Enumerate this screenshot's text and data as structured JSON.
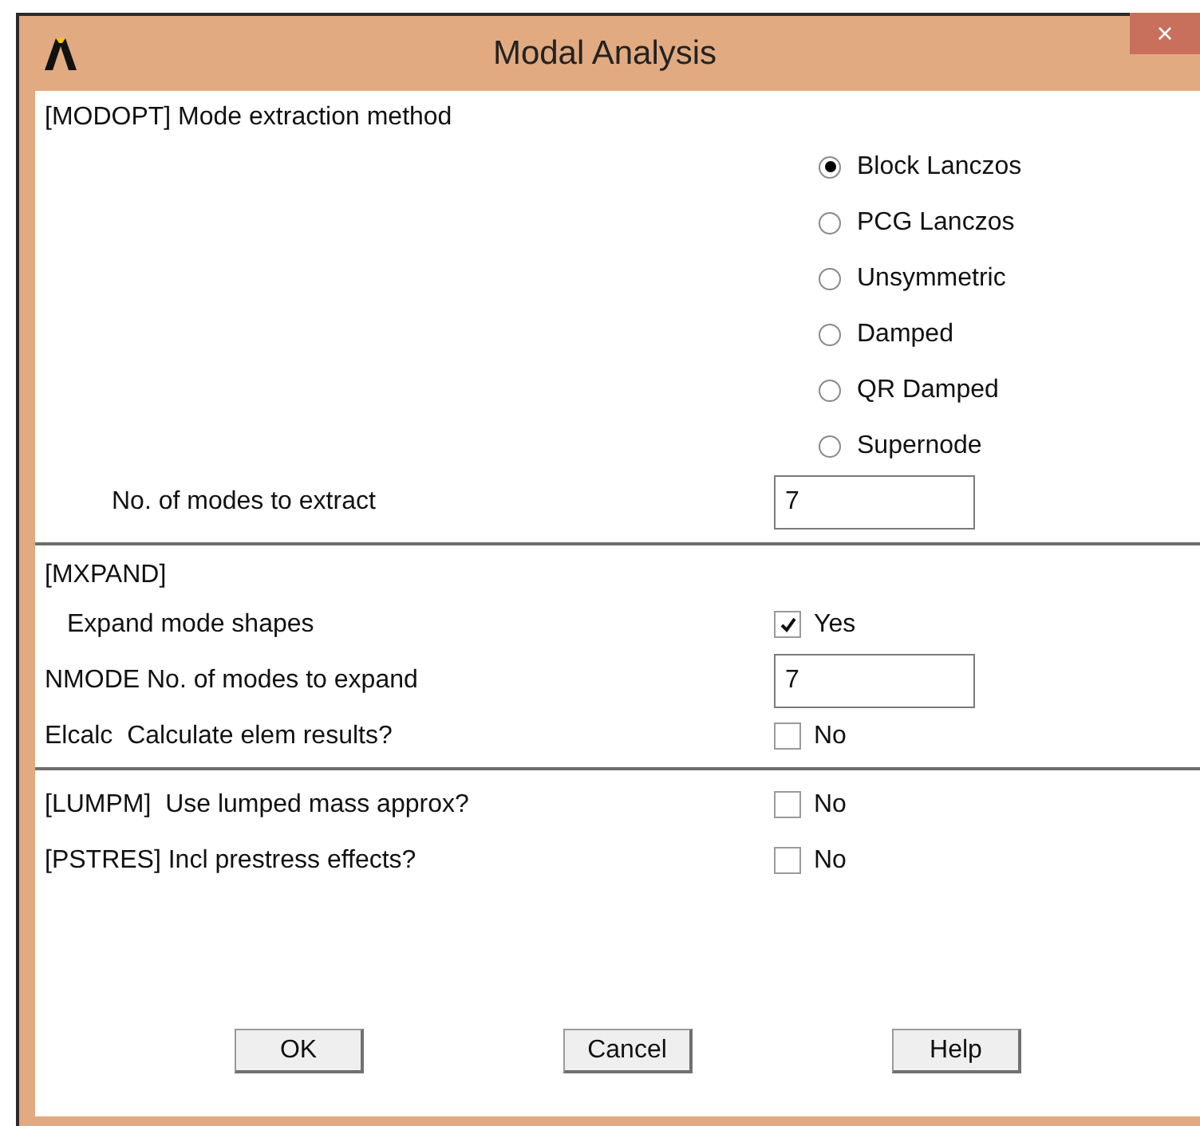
{
  "window": {
    "title": "Modal Analysis",
    "close": "×"
  },
  "sections": [
    {
      "heading": "[MODOPT] Mode extraction method",
      "items": [
        {
          "kind": "radios",
          "options": [
            {
              "label": "Block Lanczos",
              "selected": true
            },
            {
              "label": "PCG Lanczos",
              "selected": false
            },
            {
              "label": "Unsymmetric",
              "selected": false
            },
            {
              "label": "Damped",
              "selected": false
            },
            {
              "label": "QR Damped",
              "selected": false
            },
            {
              "label": "Supernode",
              "selected": false
            }
          ]
        },
        {
          "kind": "field",
          "label": "No. of modes to extract",
          "indent": true,
          "value": "7"
        }
      ]
    },
    {
      "heading": "[MXPAND]",
      "items": [
        {
          "kind": "check",
          "label": "Expand mode shapes",
          "indent": true,
          "checked": true,
          "text": "Yes"
        },
        {
          "kind": "field",
          "label": "NMODE No. of modes to expand",
          "value": "7"
        },
        {
          "kind": "check",
          "label": "Elcalc  Calculate elem results?",
          "checked": false,
          "text": "No"
        }
      ]
    },
    {
      "items": [
        {
          "kind": "check",
          "label": "[LUMPM]  Use lumped mass approx?",
          "checked": false,
          "text": "No"
        },
        {
          "kind": "check",
          "label": "[PSTRES] Incl prestress effects?",
          "checked": false,
          "text": "No"
        }
      ]
    }
  ],
  "buttons": [
    "OK",
    "Cancel",
    "Help"
  ]
}
